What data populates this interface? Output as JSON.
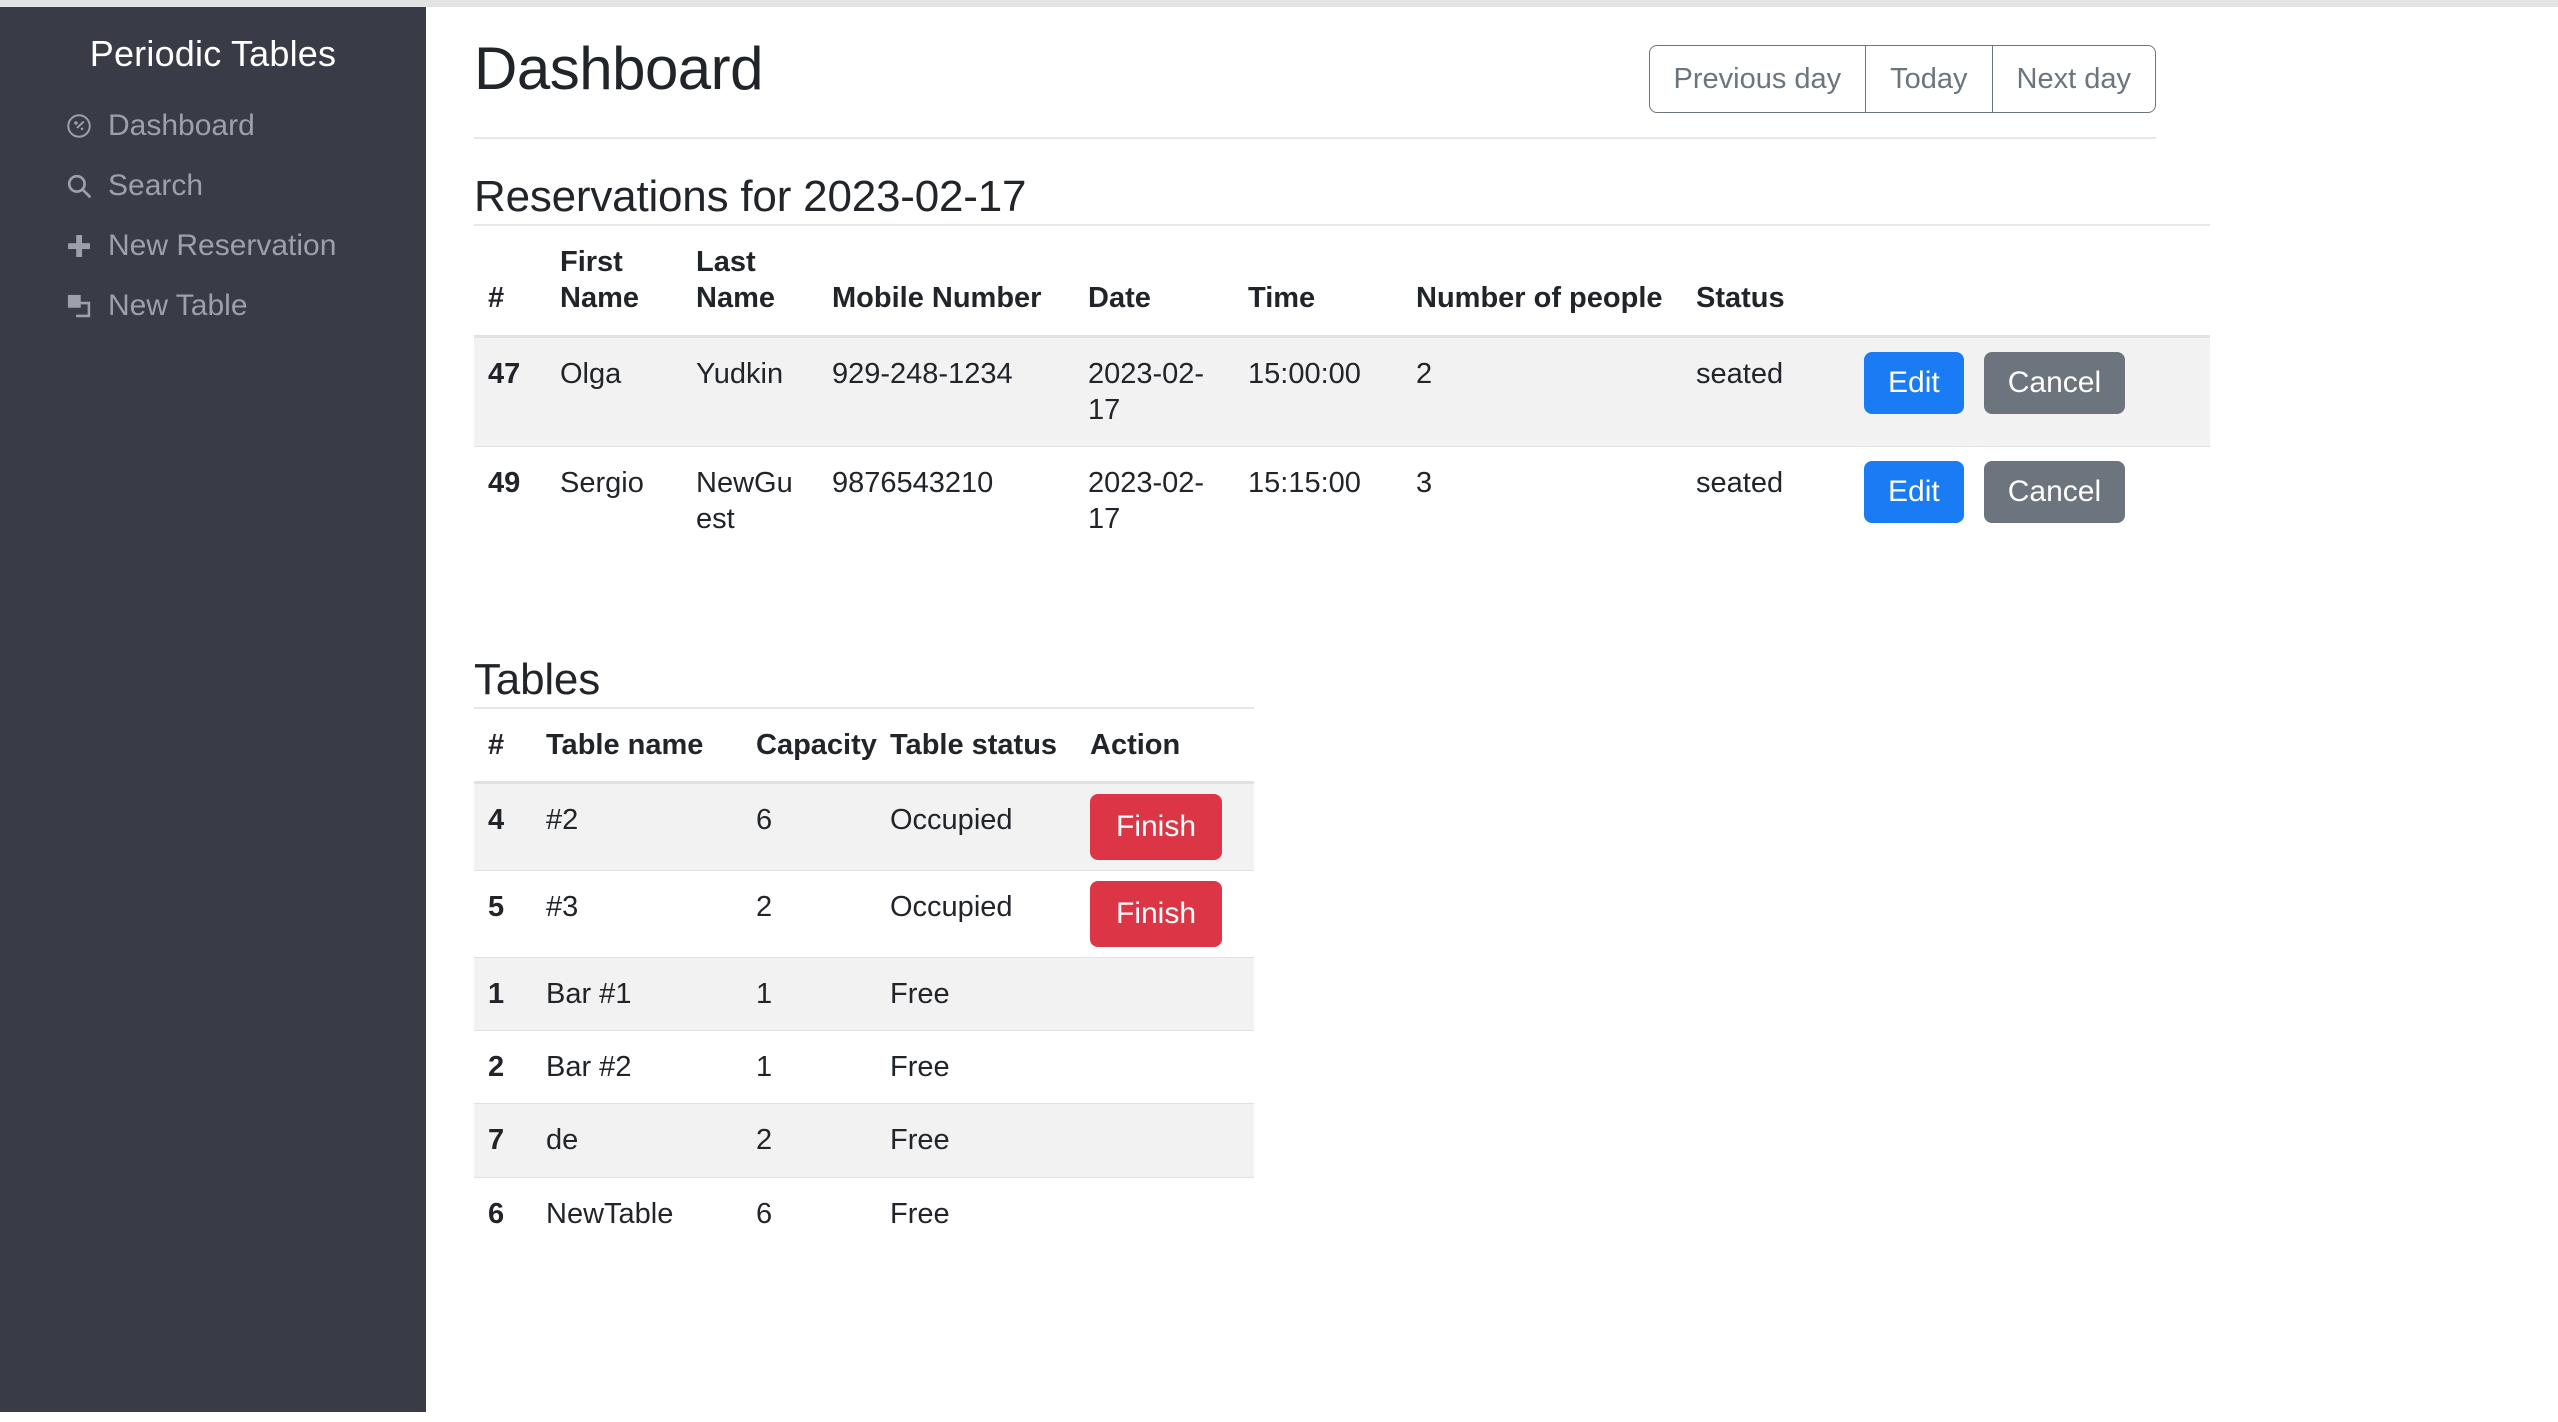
{
  "sidebar": {
    "brand": "Periodic Tables",
    "items": [
      {
        "label": "Dashboard",
        "icon": "dashboard-icon"
      },
      {
        "label": "Search",
        "icon": "search-icon"
      },
      {
        "label": "New Reservation",
        "icon": "plus-icon"
      },
      {
        "label": "New Table",
        "icon": "layers-icon"
      }
    ]
  },
  "header": {
    "title": "Dashboard",
    "day_nav": {
      "previous": "Previous day",
      "today": "Today",
      "next": "Next day"
    }
  },
  "reservations": {
    "section_title": "Reservations for 2023-02-17",
    "columns": [
      "#",
      "First Name",
      "Last Name",
      "Mobile Number",
      "Date",
      "Time",
      "Number of people",
      "Status",
      ""
    ],
    "rows": [
      {
        "id": "47",
        "first_name": "Olga",
        "last_name": "Yudkin",
        "mobile_number": "929-248-1234",
        "date": "2023-02-17",
        "time": "15:00:00",
        "people": "2",
        "status": "seated",
        "edit_label": "Edit",
        "cancel_label": "Cancel"
      },
      {
        "id": "49",
        "first_name": "Sergio",
        "last_name": "NewGuest",
        "mobile_number": "9876543210",
        "date": "2023-02-17",
        "time": "15:15:00",
        "people": "3",
        "status": "seated",
        "edit_label": "Edit",
        "cancel_label": "Cancel"
      }
    ]
  },
  "tables": {
    "section_title": "Tables",
    "columns": [
      "#",
      "Table name",
      "Capacity",
      "Table status",
      "Action"
    ],
    "rows": [
      {
        "id": "4",
        "name": "#2",
        "capacity": "6",
        "status": "Occupied",
        "action_label": "Finish"
      },
      {
        "id": "5",
        "name": "#3",
        "capacity": "2",
        "status": "Occupied",
        "action_label": "Finish"
      },
      {
        "id": "1",
        "name": "Bar #1",
        "capacity": "1",
        "status": "Free",
        "action_label": ""
      },
      {
        "id": "2",
        "name": "Bar #2",
        "capacity": "1",
        "status": "Free",
        "action_label": ""
      },
      {
        "id": "7",
        "name": "de",
        "capacity": "2",
        "status": "Free",
        "action_label": ""
      },
      {
        "id": "6",
        "name": "NewTable",
        "capacity": "6",
        "status": "Free",
        "action_label": ""
      }
    ]
  },
  "colors": {
    "sidebar_bg": "#393b46",
    "sidebar_text": "#9ca0a8",
    "primary": "#1a7cf5",
    "secondary": "#6c757d",
    "danger": "#dc3545",
    "stripe": "#f2f2f2"
  }
}
